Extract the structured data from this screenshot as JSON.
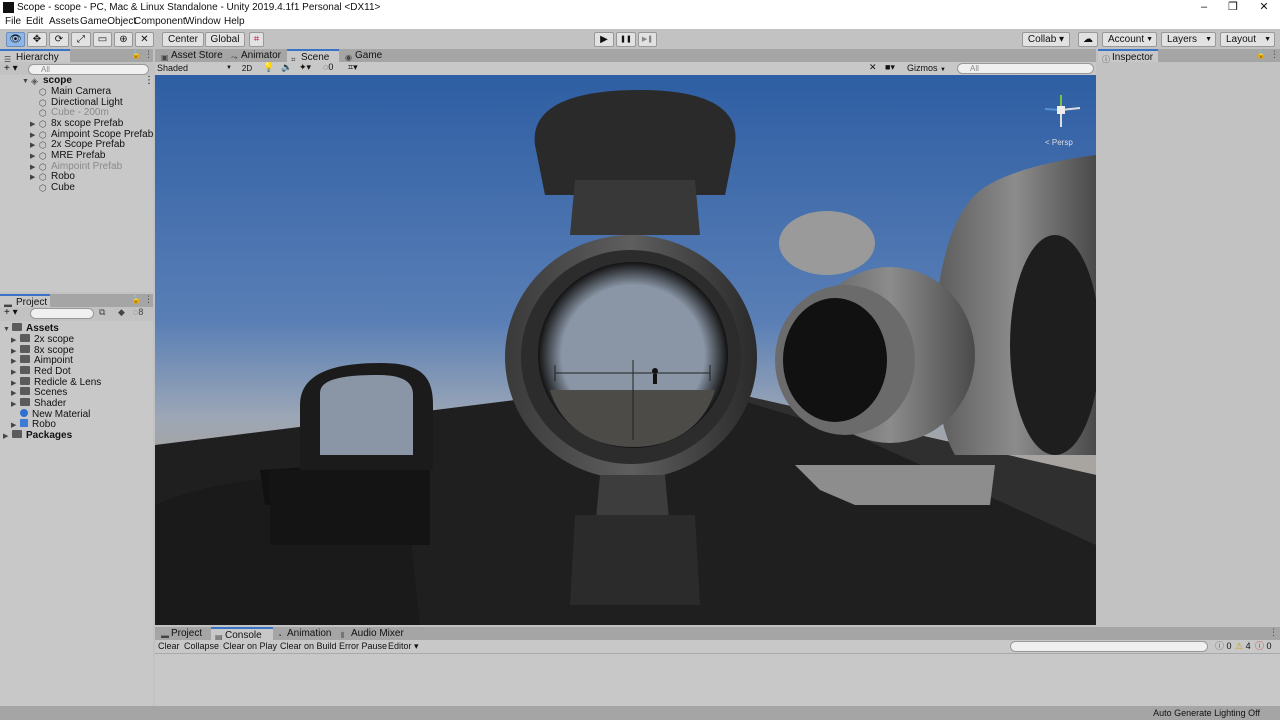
{
  "window": {
    "title": "Scope - scope - PC, Mac & Linux Standalone - Unity 2019.4.1f1 Personal <DX11>",
    "minimize": "–",
    "restore": "❐",
    "close": "✕"
  },
  "menu": [
    "File",
    "Edit",
    "Assets",
    "GameObject",
    "Component",
    "Window",
    "Help"
  ],
  "toolbar": {
    "pivot": "Center",
    "space": "Global",
    "collab": "Collab ▾",
    "account": "Account",
    "layers": "Layers",
    "layout": "Layout",
    "play_icon": "▶",
    "pause_icon": "❚❚",
    "step_icon": "▶❚",
    "cloud_icon": "☁"
  },
  "hierarchy": {
    "tab": "Hierarchy",
    "add": "+ ▾",
    "search_placeholder": "All",
    "scene": "scope",
    "items": [
      {
        "label": "Main Camera",
        "dim": false,
        "expandable": false
      },
      {
        "label": "Directional Light",
        "dim": false,
        "expandable": false
      },
      {
        "label": "Cube - 200m",
        "dim": true,
        "expandable": false
      },
      {
        "label": "8x scope Prefab",
        "dim": false,
        "expandable": true
      },
      {
        "label": "Aimpoint Scope Prefab",
        "dim": false,
        "expandable": true
      },
      {
        "label": "2x Scope Prefab",
        "dim": false,
        "expandable": true
      },
      {
        "label": "MRE Prefab",
        "dim": false,
        "expandable": true
      },
      {
        "label": "Aimpoint Prefab",
        "dim": true,
        "expandable": true
      },
      {
        "label": "Robo",
        "dim": false,
        "expandable": true
      },
      {
        "label": "Cube",
        "dim": false,
        "expandable": false
      }
    ]
  },
  "project": {
    "tab": "Project",
    "add": "+ ▾",
    "hidden_count": "8",
    "root": "Assets",
    "items": [
      "2x scope",
      "8x scope",
      "Aimpoint",
      "Red Dot",
      "Redicle & Lens",
      "Scenes",
      "Shader",
      "New Material",
      "Robo"
    ],
    "item_types": [
      "folder",
      "folder",
      "folder",
      "folder",
      "folder",
      "folder",
      "folder",
      "material",
      "prefab"
    ],
    "packages": "Packages"
  },
  "center_tabs": [
    "Asset Store",
    "Animator",
    "Scene",
    "Game"
  ],
  "scene": {
    "shading": "Shaded",
    "mode_2d": "2D",
    "hidden_count": "0",
    "gizmos": "Gizmos",
    "search_placeholder": "All",
    "persp": "< Persp",
    "sky_top": "#4a77b8",
    "sky_horizon": "#a9a8a6",
    "ground": "#2a2a2a"
  },
  "inspector": {
    "tab": "Inspector"
  },
  "console": {
    "tabs": [
      "Project",
      "Console",
      "Animation",
      "Audio Mixer"
    ],
    "buttons": [
      "Clear",
      "Collapse",
      "Clear on Play",
      "Clear on Build",
      "Error Pause",
      "Editor ▾"
    ],
    "errors": "0",
    "warnings": "4",
    "messages": "0"
  },
  "status": {
    "right": "Auto Generate Lighting Off"
  }
}
